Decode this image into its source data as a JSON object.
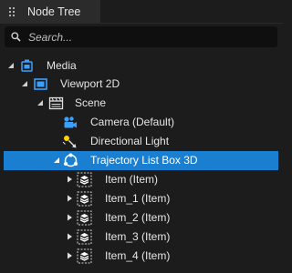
{
  "panel": {
    "tab_label": "Node Tree",
    "tab_icon": "panel-drag-handle-icon"
  },
  "search": {
    "placeholder": "Search...",
    "value": "",
    "icon": "search-icon"
  },
  "tree": {
    "media": {
      "label": "Media",
      "icon": "media-icon",
      "expanded": true
    },
    "viewport": {
      "label": "Viewport 2D",
      "icon": "viewport-icon",
      "expanded": true
    },
    "scene": {
      "label": "Scene",
      "icon": "scene-icon",
      "expanded": true
    },
    "camera": {
      "label": "Camera (Default)",
      "icon": "camera-icon"
    },
    "light": {
      "label": "Directional Light",
      "icon": "directional-light-icon"
    },
    "trajectory": {
      "label": "Trajectory List Box 3D",
      "icon": "trajectory-list-box-icon",
      "expanded": true,
      "selected": true
    },
    "items": [
      {
        "label": "Item (Item)",
        "icon": "item-icon",
        "expanded": false
      },
      {
        "label": "Item_1 (Item)",
        "icon": "item-icon",
        "expanded": false
      },
      {
        "label": "Item_2 (Item)",
        "icon": "item-icon",
        "expanded": false
      },
      {
        "label": "Item_3 (Item)",
        "icon": "item-icon",
        "expanded": false
      },
      {
        "label": "Item_4 (Item)",
        "icon": "item-icon",
        "expanded": false
      }
    ]
  },
  "colors": {
    "background": "#1c1c1c",
    "tab_background": "#2b2b2b",
    "search_background": "#0f0f0f",
    "selection": "#1a7fd0",
    "icon_blue": "#3aa0ff",
    "text": "#e6e6e6"
  }
}
